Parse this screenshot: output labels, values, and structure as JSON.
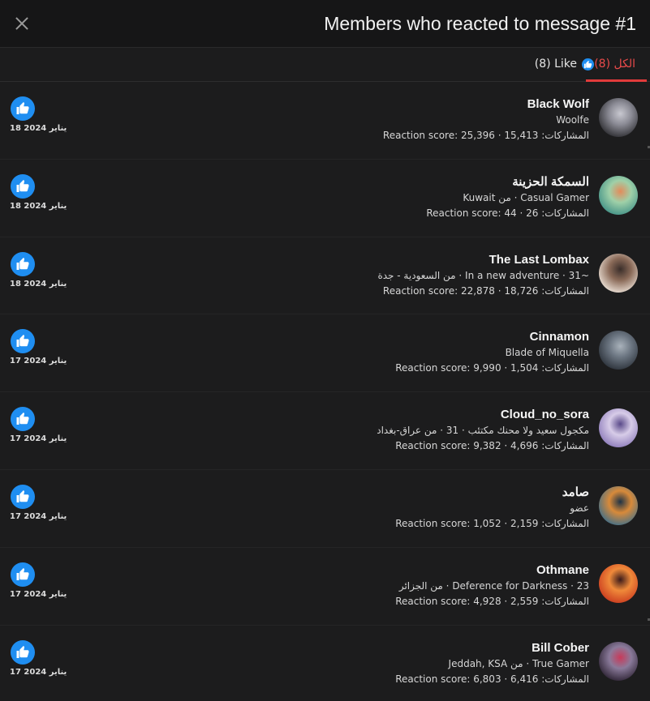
{
  "header": {
    "title": "Members who reacted to message #1",
    "close_icon": "close-icon"
  },
  "tabs": {
    "all_label": "الكل (8)",
    "like_label": "(8) Like",
    "like_icon": "thumbs-up-icon"
  },
  "colors": {
    "accent_red": "#e23b3b",
    "like_blue": "#1f8ef1",
    "background": "#1c1c1d"
  },
  "members": [
    {
      "name": "Black Wolf",
      "subtitle": "Woolfe",
      "stats": "المشاركات: 15,413 · Reaction score: 25,396",
      "date": "18 يناير 2024",
      "avatar_colors": [
        "#2a2a2e",
        "#8c8c96",
        "#c8c8d0"
      ]
    },
    {
      "name": "السمكة الحزينة",
      "subtitle": "Casual Gamer · من Kuwait",
      "stats": "المشاركات: 26 · Reaction score: 44",
      "date": "18 يناير 2024",
      "avatar_colors": [
        "#3f8f86",
        "#9fd0a8",
        "#e38b5a"
      ]
    },
    {
      "name": "The Last Lombax",
      "subtitle": "~In a new adventure · 31 · من السعودية - جدة",
      "stats": "المشاركات: 18,726 · Reaction score: 22,878",
      "date": "18 يناير 2024",
      "avatar_colors": [
        "#f0e6dc",
        "#8a6a58",
        "#3a2e2a"
      ]
    },
    {
      "name": "Cinnamon",
      "subtitle": "Blade of Miquella",
      "stats": "المشاركات: 1,504 · Reaction score: 9,990",
      "date": "17 يناير 2024",
      "avatar_colors": [
        "#2a3038",
        "#6c7682",
        "#a9b2bb"
      ]
    },
    {
      "name": "Cloud_no_sora",
      "subtitle": "مكجول سعيد ولا محنك مكتئب · 31 · من عراق-بغداد",
      "stats": "المشاركات: 4,696 · Reaction score: 9,382",
      "date": "17 يناير 2024",
      "avatar_colors": [
        "#8a78b8",
        "#d7cce8",
        "#5a4a8a"
      ]
    },
    {
      "name": "صامد",
      "subtitle": "عضو",
      "stats": "المشاركات: 2,159 · Reaction score: 1,052",
      "date": "17 يناير 2024",
      "avatar_colors": [
        "#3b6e8c",
        "#d88a3a",
        "#1e3346"
      ]
    },
    {
      "name": "Othmane",
      "subtitle": "Deference for Darkness · 23 · من الجزائر",
      "stats": "المشاركات: 2,559 · Reaction score: 4,928",
      "date": "17 يناير 2024",
      "avatar_colors": [
        "#c8381e",
        "#f08a3a",
        "#3a1a1a"
      ]
    },
    {
      "name": "Bill Cober",
      "subtitle": "True Gamer · من Jeddah, KSA",
      "stats": "المشاركات: 6,416 · Reaction score: 6,803",
      "date": "17 يناير 2024",
      "avatar_colors": [
        "#2a2030",
        "#8a7a9a",
        "#c83a5a"
      ]
    }
  ]
}
